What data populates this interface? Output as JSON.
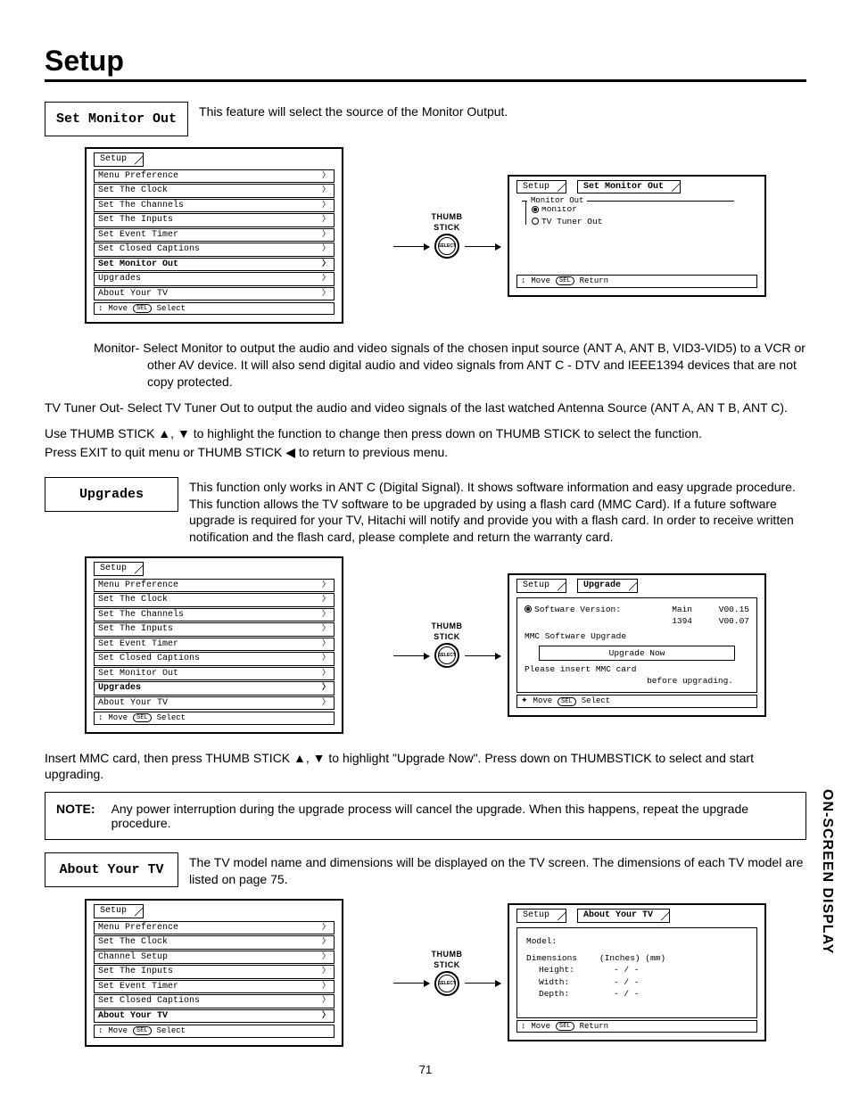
{
  "page_title": "Setup",
  "page_number": "71",
  "sidebar_label": "ON-SCREEN DISPLAY",
  "thumb_label_top": "THUMB",
  "thumb_label_bot": "STICK",
  "thumb_inner": "SELECT",
  "sec1": {
    "label": "Set Monitor Out",
    "desc": "This feature will select the source of the Monitor Output.",
    "menu_items": [
      "Menu Preference",
      "Set The Clock",
      "Set The Channels",
      "Set The Inputs",
      "Set Event Timer",
      "Set Closed Captions",
      "Set Monitor Out",
      "Upgrades",
      "About Your TV"
    ],
    "bold_idx": 6,
    "footer": "↕ Move  SEL  Select",
    "right_tab": "Set Monitor Out",
    "right_group_label": "Monitor Out",
    "opt1": "Monitor",
    "opt2": "TV Tuner Out",
    "right_footer": "↕ Move  SEL  Return",
    "body_monitor": "Monitor- Select Monitor to output the audio and video signals of the chosen input source (ANT A, ANT B, VID3-VID5) to a VCR or other AV device.  It will also send digital audio and video signals from ANT C - DTV and IEEE1394 devices that are not copy protected.",
    "body_tvtuner": "TV Tuner Out- Select TV Tuner Out to output the audio and video signals of the last watched Antenna Source (ANT A, AN T B, ANT C).",
    "body_use1": "Use THUMB STICK ▲, ▼ to highlight the function to change then press down on THUMB STICK to select the function.",
    "body_use2": "Press EXIT to quit menu or THUMB STICK ◀ to return to previous menu."
  },
  "sec2": {
    "label": "Upgrades",
    "desc": "This function only works in ANT C (Digital Signal).  It shows software information and easy upgrade procedure.  This function allows the TV software to be upgraded by using a flash card (MMC Card).  If a future software upgrade is required for your TV, Hitachi will notify and provide you with a flash card.  In order to receive written notification and the flash card, please complete and return the warranty card.",
    "menu_items": [
      "Menu Preference",
      "Set The Clock",
      "Set The Channels",
      "Set The Inputs",
      "Set Event Timer",
      "Set Closed Captions",
      "Set Monitor Out",
      "Upgrades",
      "About Your TV"
    ],
    "bold_idx": 7,
    "footer": "↕ Move  SEL  Select",
    "right_tab": "Upgrade",
    "sv_label": "Software Version:",
    "sv_main_l": "Main",
    "sv_main_v": "V00.15",
    "sv_1394_l": "1394",
    "sv_1394_v": "V00.07",
    "mmc_label": "MMC Software Upgrade",
    "upgrade_btn": "Upgrade Now",
    "msg1": "Please insert MMC card",
    "msg2": "before upgrading.",
    "right_footer": "✦ Move  SEL  Select",
    "body_insert": "Insert MMC card, then press THUMB STICK ▲, ▼ to highlight \"Upgrade Now\".  Press down on THUMBSTICK to select and start upgrading."
  },
  "note": {
    "label": "NOTE:",
    "text": "Any power interruption during the upgrade process will cancel the upgrade.  When this happens, repeat the upgrade procedure."
  },
  "sec3": {
    "label": "About Your TV",
    "desc": "The TV model name and dimensions will be displayed on the TV screen.  The dimensions of each TV model are listed on page 75.",
    "menu_items": [
      "Menu Preference",
      "Set The Clock",
      "Channel Setup",
      "Set The Inputs",
      "Set Event Timer",
      "Set Closed Captions",
      "About Your TV"
    ],
    "bold_idx": 6,
    "footer": "↕ Move  SEL  Select",
    "right_tab": "About Your TV",
    "model_label": "Model:",
    "dims_header_l": "Dimensions",
    "dims_header_r": "(Inches) (mm)",
    "h_l": "Height:",
    "h_v": "- / -",
    "w_l": "Width:",
    "w_v": "- / -",
    "d_l": "Depth:",
    "d_v": "- / -",
    "right_footer": "↕ Move  SEL  Return"
  },
  "tab_setup": "Setup"
}
